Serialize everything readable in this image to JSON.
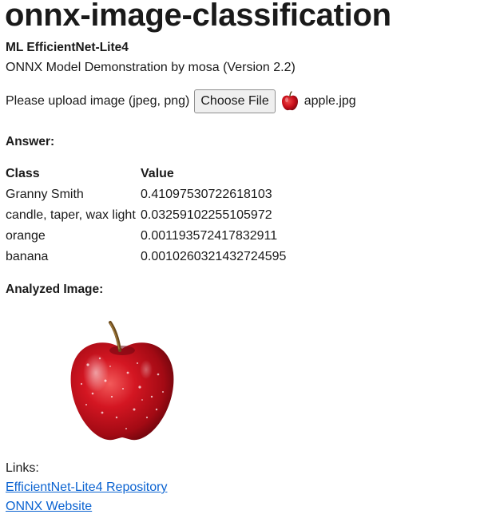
{
  "page": {
    "title": "onnx-image-classification",
    "subtitle": "ML EfficientNet-Lite4",
    "description": "ONNX Model Demonstration by mosa (Version 2.2)"
  },
  "upload": {
    "label": "Please upload image (jpeg, png)",
    "button_label": "Choose File",
    "file_icon": "apple-icon",
    "file_name": "apple.jpg"
  },
  "answer": {
    "heading": "Answer:",
    "columns": [
      "Class",
      "Value"
    ],
    "rows": [
      {
        "class": "Granny Smith",
        "value": "0.41097530722618103"
      },
      {
        "class": "candle, taper, wax light",
        "value": "0.03259102255105972"
      },
      {
        "class": "orange",
        "value": "0.001193572417832911"
      },
      {
        "class": "banana",
        "value": "0.0010260321432724595"
      }
    ]
  },
  "analyzed": {
    "heading": "Analyzed Image:",
    "image": "apple-image"
  },
  "links": {
    "label": "Links:",
    "items": [
      {
        "label": "EfficientNet-Lite4 Repository"
      },
      {
        "label": "ONNX Website"
      }
    ],
    "link_color": "#0b63d1"
  }
}
